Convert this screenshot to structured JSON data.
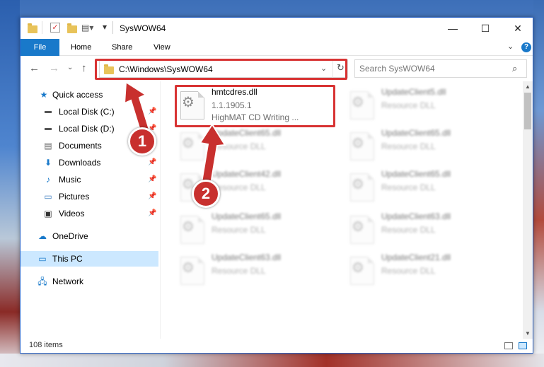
{
  "window": {
    "title": "SysWOW64",
    "controls": {
      "minimize": "—",
      "maximize": "☐",
      "close": "✕"
    }
  },
  "ribbon": {
    "tabs": [
      "File",
      "Home",
      "Share",
      "View"
    ],
    "help": "?"
  },
  "address": {
    "path": "C:\\Windows\\SysWOW64"
  },
  "search": {
    "placeholder": "Search SysWOW64"
  },
  "nav": {
    "items": [
      {
        "label": "Quick access",
        "icon": "star-icon"
      },
      {
        "label": "Local Disk (C:)",
        "icon": "drive-icon",
        "pinned": true
      },
      {
        "label": "Local Disk (D:)",
        "icon": "drive-icon",
        "pinned": true
      },
      {
        "label": "Documents",
        "icon": "documents-icon",
        "pinned": true
      },
      {
        "label": "Downloads",
        "icon": "download-icon",
        "pinned": true
      },
      {
        "label": "Music",
        "icon": "music-icon",
        "pinned": true
      },
      {
        "label": "Pictures",
        "icon": "pictures-icon",
        "pinned": true
      },
      {
        "label": "Videos",
        "icon": "videos-icon",
        "pinned": true
      },
      {
        "label": "OneDrive",
        "icon": "cloud-icon"
      },
      {
        "label": "This PC",
        "icon": "computer-icon",
        "selected": true
      },
      {
        "label": "Network",
        "icon": "network-icon"
      }
    ]
  },
  "files": {
    "featured": {
      "name": "hmtcdres.dll",
      "version": "1.1.1905.1",
      "description": "HighMAT CD Writing ..."
    },
    "items": [
      {
        "name": "UpdateClient5.dll",
        "type": "Resource DLL"
      },
      {
        "name": "UpdateClient65.dll",
        "type": "Resource DLL"
      },
      {
        "name": "UpdateClient65.dll",
        "type": "Resource DLL"
      },
      {
        "name": "UpdateClient42.dll",
        "type": "Resource DLL"
      },
      {
        "name": "UpdateClient65.dll",
        "type": "Resource DLL"
      },
      {
        "name": "UpdateClient65.dll",
        "type": "Resource DLL"
      },
      {
        "name": "UpdateClient63.dll",
        "type": "Resource DLL"
      },
      {
        "name": "UpdateClient63.dll",
        "type": "Resource DLL"
      },
      {
        "name": "UpdateClient21.dll",
        "type": "Resource DLL"
      }
    ]
  },
  "status": {
    "item_count": "108 items"
  },
  "callouts": {
    "one": "1",
    "two": "2"
  },
  "colors": {
    "accent": "#1979ca",
    "highlight": "#d83333",
    "selection": "#cce8ff"
  }
}
